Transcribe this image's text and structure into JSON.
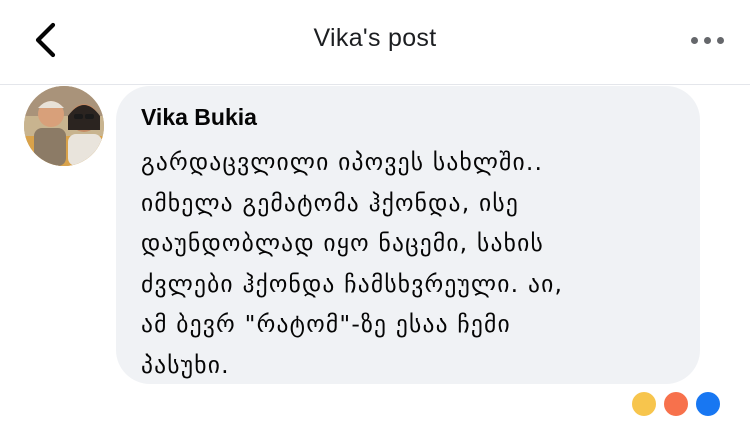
{
  "header": {
    "title": "Vika's post",
    "back_icon": "chevron-left-icon",
    "more_icon": "more-horizontal-icon"
  },
  "comment": {
    "author": "Vika Bukia",
    "text": "გარდაცვლილი იპოვეს სახლში..\nიმხელა გემატომა ჰქონდა, ისე\nდაუნდობლად იყო ნაცემი, სახის\nძვლები ჰქონდა ჩამსხვრეული. აი,\nამ ბევრ \"რატომ\"-ზე ესაა ჩემი\nპასუხი."
  },
  "colors": {
    "bubble": "#f0f2f5",
    "meta_text": "#8a8d91",
    "like_blue": "#1877f2",
    "angry_orange": "#f7714c",
    "sad_yellow": "#f7c54d"
  }
}
